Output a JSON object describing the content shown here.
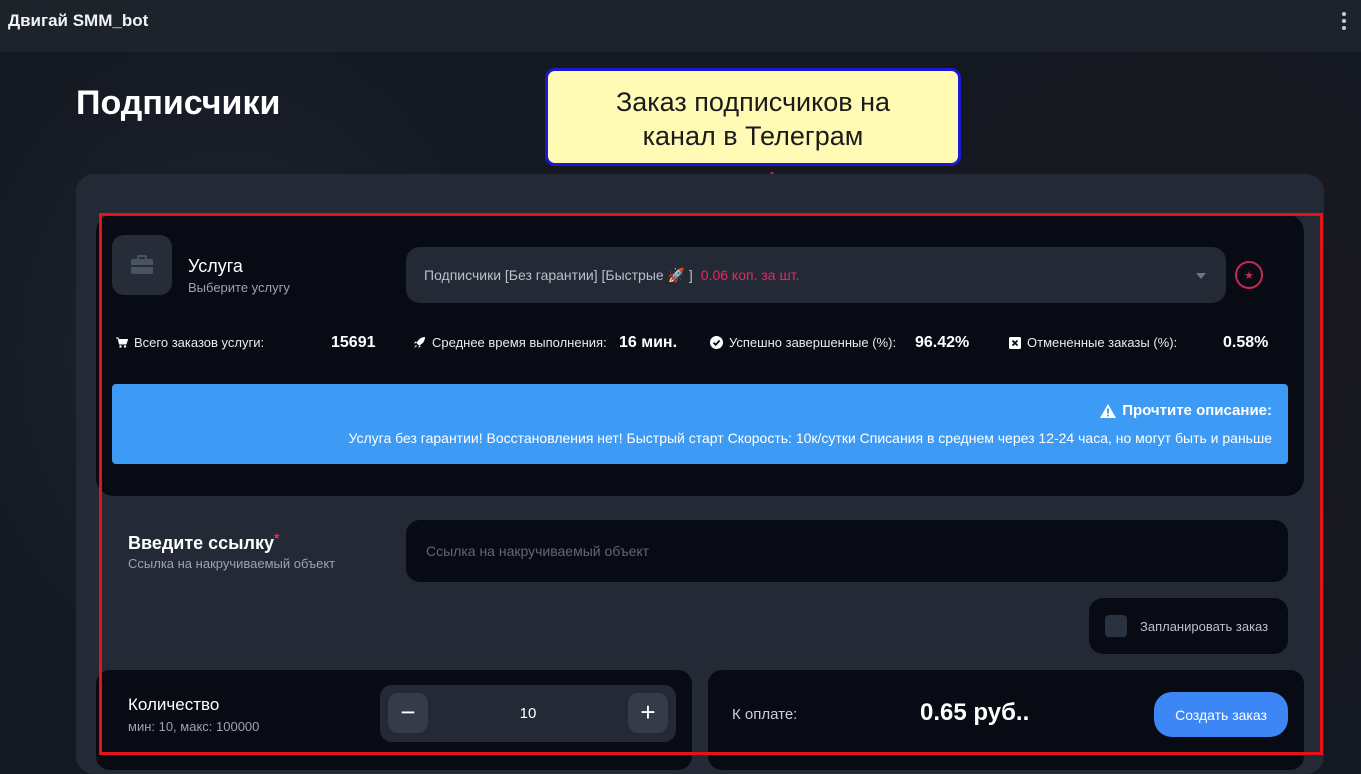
{
  "app": {
    "title": "Двигай SMM_bot"
  },
  "page": {
    "title": "Подписчики"
  },
  "annotation": {
    "line1": "Заказ подписчиков на",
    "line2": "канал в Телеграм"
  },
  "service": {
    "label": "Услуга",
    "sublabel": "Выберите услугу",
    "selected": "Подписчики [Без гарантии] [Быстрые 🚀 ]",
    "price": "0.06 коп. за шт."
  },
  "stats": {
    "orders_label": "Всего заказов услуги:",
    "orders_value": "15691",
    "time_label": "Среднее время выполнения:",
    "time_value": "16 мин.",
    "success_label": "Успешно завершенные (%):",
    "success_value": "96.42%",
    "cancel_label": "Отмененные заказы (%):",
    "cancel_value": "0.58%"
  },
  "info": {
    "title": "Прочтите описание:",
    "text": "Услуга без гарантии! Восстановления нет! Быстрый старт Скорость: 10к/сутки Списания в среднем через 12-24 часа, но могут быть и раньше"
  },
  "link": {
    "label": "Введите ссылку",
    "required_mark": "*",
    "sublabel": "Ссылка на накручиваемый объект",
    "placeholder": "Ссылка на накручиваемый объект",
    "value": ""
  },
  "schedule": {
    "label": "Запланировать заказ",
    "checked": false
  },
  "quantity": {
    "label": "Количество",
    "sublabel": "мин: 10, макс: 100000",
    "value": "10",
    "minus": "−",
    "plus": "+"
  },
  "payment": {
    "label": "К оплате:",
    "amount": "0.65 руб..",
    "button": "Создать заказ"
  },
  "colors": {
    "accent_blue": "#3d86f5",
    "info_blue": "#3d9bf5",
    "price_pink": "#e52a63",
    "annotation_frame": "#e3121b"
  }
}
